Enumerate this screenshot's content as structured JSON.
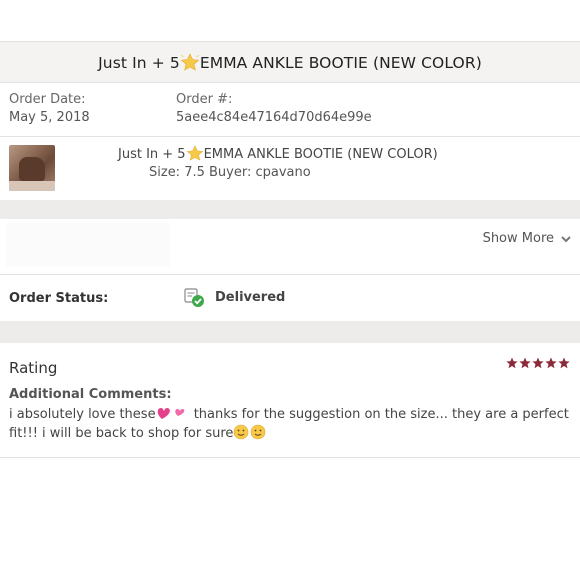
{
  "header": {
    "title_prefix": "Just In + 5",
    "title_suffix": "EMMA ANKLE BOOTIE (NEW COLOR)",
    "title_icon": "glowing-star-icon"
  },
  "order": {
    "date_label": "Order Date:",
    "date_value": "May 5, 2018",
    "number_label": "Order #:",
    "number_value": "5aee4c84e47164d70d64e99e"
  },
  "item": {
    "thumbnail_icon": "product-thumbnail",
    "title_prefix": "Just In + 5",
    "title_suffix": "EMMA ANKLE BOOTIE (NEW COLOR)",
    "details": "Size: 7.5  Buyer: cpavano"
  },
  "show_more": {
    "label": "Show More",
    "icon": "chevron-down-icon"
  },
  "status": {
    "label": "Order Status:",
    "value": "Delivered",
    "icon": "delivered-check-icon",
    "accent": "#3ea84b"
  },
  "rating": {
    "title": "Rating",
    "stars": 5,
    "star_color": "#8b2a3a",
    "comments_label": "Additional Comments:",
    "comment_part1": "i absolutely love these",
    "comment_part2": " thanks for the suggestion on the size... they are a perfect fit!!! i will be back to shop for sure"
  }
}
